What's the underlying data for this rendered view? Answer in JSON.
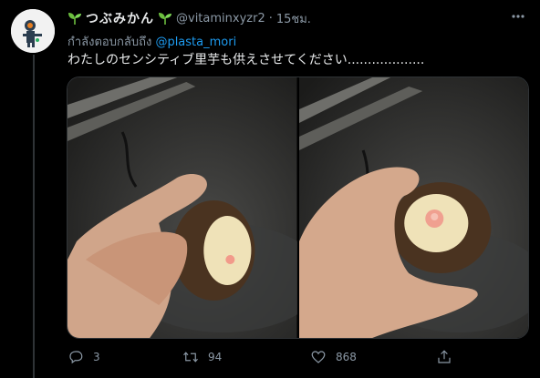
{
  "tweet": {
    "display_name": "つぶみかん",
    "handle": "@vitaminxyzr2",
    "separator": "·",
    "time": "15ชม.",
    "replying_prefix": "กำลังตอบกลับถึง",
    "replying_to": "@plasta_mori",
    "text": "わたしのセンシティブ里芋も供えさせてください...................",
    "actions": {
      "reply_count": "3",
      "retweet_count": "94",
      "like_count": "868"
    }
  },
  "icons": {
    "name_decoration": "sprout-icon",
    "more": "more-options-icon",
    "reply": "reply-icon",
    "retweet": "retweet-icon",
    "like": "heart-icon",
    "share": "share-icon"
  },
  "colors": {
    "background": "#000000",
    "mention": "#1d9bf0",
    "muted": "#8b98a5",
    "sprout": "#6cbf3f"
  }
}
